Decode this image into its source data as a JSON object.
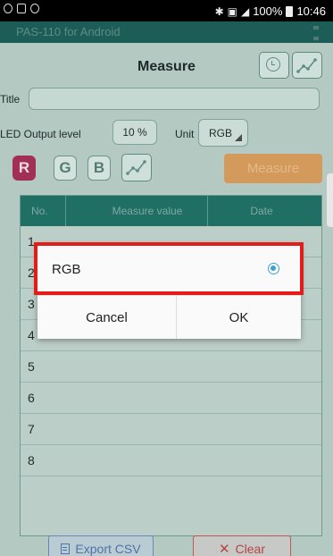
{
  "status_bar": {
    "battery": "100%",
    "time": "10:46",
    "icons": [
      "shield-icon",
      "image-icon",
      "alarm-icon",
      "bluetooth-icon",
      "nfc-icon",
      "signal-icon",
      "battery-icon"
    ]
  },
  "app_bar": {
    "app_name": "PAS-110 for Android",
    "menu_icon": "overflow-menu-icon"
  },
  "screen": {
    "title": "Measure",
    "title_field_label": "Title",
    "title_field_value": "",
    "led_output_label": "LED Output level",
    "led_output_value": "10 %",
    "unit_label": "Unit",
    "unit_value": "RGB",
    "channel_buttons": [
      "R",
      "G",
      "B"
    ],
    "measure_label": "Measure",
    "table": {
      "headers": [
        "No.",
        "Measure value",
        "Date"
      ],
      "row_numbers": [
        "1",
        "2",
        "3",
        "4",
        "5",
        "6",
        "7",
        "8"
      ]
    },
    "export_csv_label": "Export CSV",
    "clear_label": "Clear"
  },
  "dialog": {
    "option_label": "RGB",
    "option_selected": true,
    "cancel_label": "Cancel",
    "ok_label": "OK"
  },
  "colors": {
    "app_bar": "#1c5e57",
    "background": "#b5c9c3",
    "table_header": "#1f6f65",
    "r_button": "#a12f56",
    "measure_button": "#d49a5b",
    "highlight": "#e21b1b",
    "radio": "#3aa0d8"
  }
}
